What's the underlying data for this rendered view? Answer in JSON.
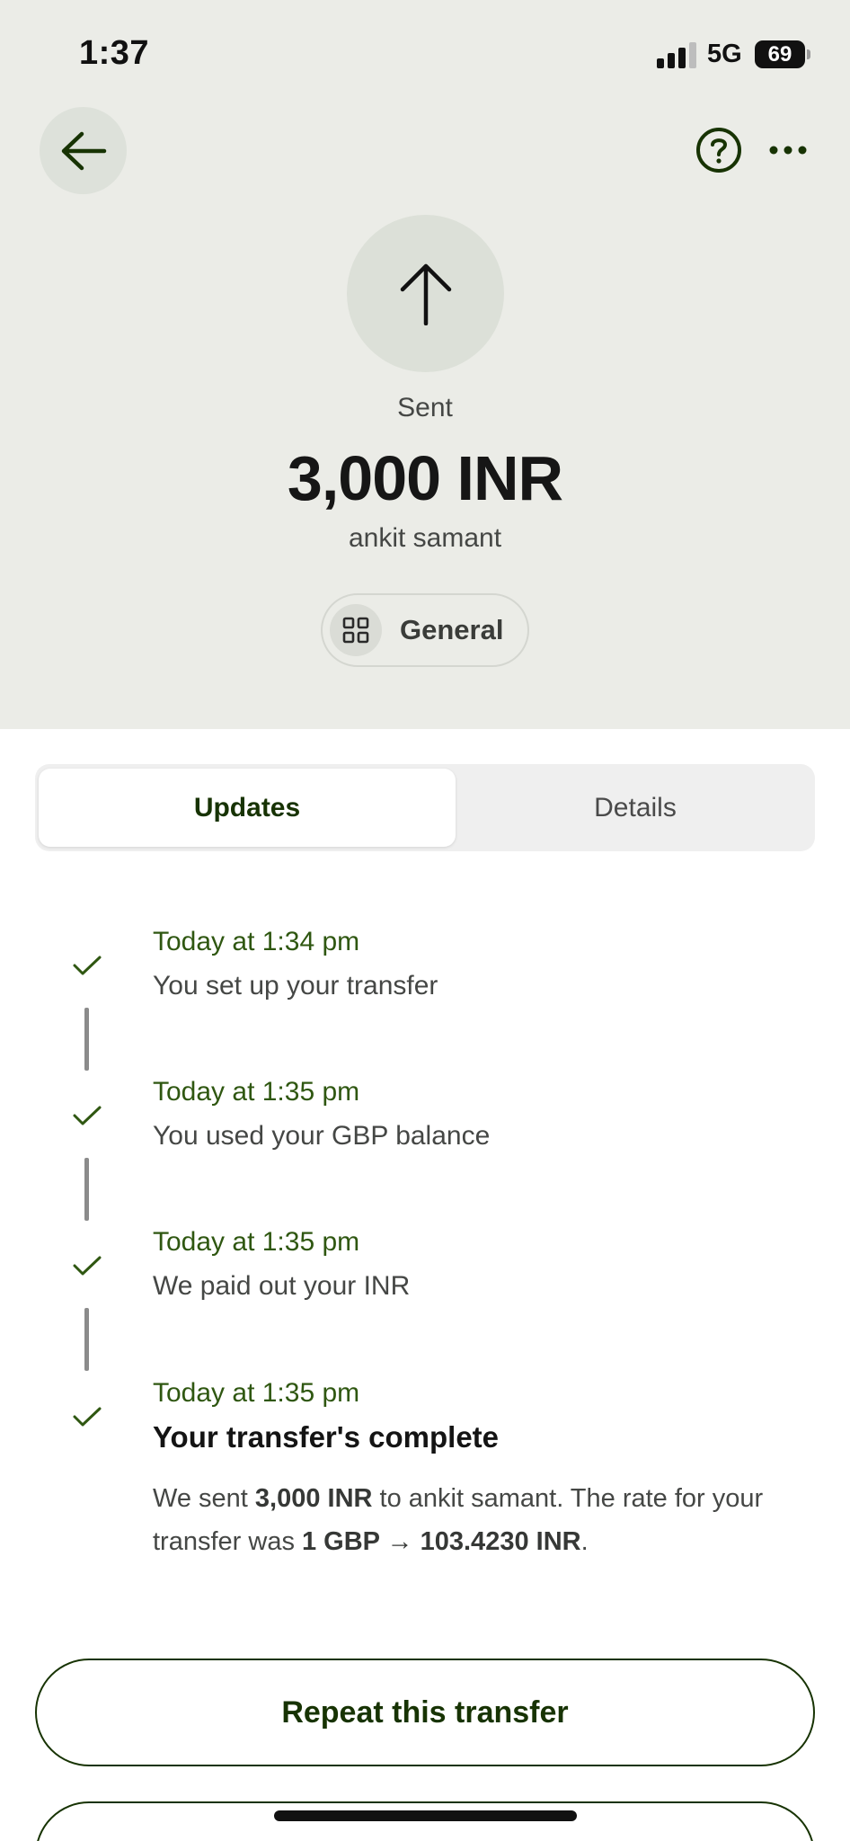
{
  "status_bar": {
    "time": "1:37",
    "network": "5G",
    "battery": "69"
  },
  "header": {
    "back_icon": "arrow-left-icon",
    "help_icon": "question-circle-icon",
    "more_icon": "ellipsis-icon"
  },
  "transfer": {
    "direction_icon": "arrow-up-icon",
    "status": "Sent",
    "amount": "3,000 INR",
    "recipient": "ankit samant",
    "category": {
      "icon": "grid-icon",
      "label": "General"
    }
  },
  "tabs": [
    {
      "label": "Updates",
      "active": true
    },
    {
      "label": "Details",
      "active": false
    }
  ],
  "updates": [
    {
      "time": "Today at 1:34 pm",
      "text": "You set up your transfer"
    },
    {
      "time": "Today at 1:35 pm",
      "text": "You used your GBP balance"
    },
    {
      "time": "Today at 1:35 pm",
      "text": "We paid out your INR"
    },
    {
      "time": "Today at 1:35 pm",
      "title": "Your transfer's complete",
      "body": {
        "part1": "We sent ",
        "amount": "3,000 INR",
        "part2": " to ankit samant. The rate for your transfer was ",
        "rate": "1 GBP → 103.4230 INR",
        "part3": "."
      }
    }
  ],
  "actions": {
    "repeat_label": "Repeat this transfer"
  },
  "colors": {
    "accent_dark_green": "#173303",
    "timestamp_green": "#2f5711",
    "header_bg": "#ebece7"
  }
}
